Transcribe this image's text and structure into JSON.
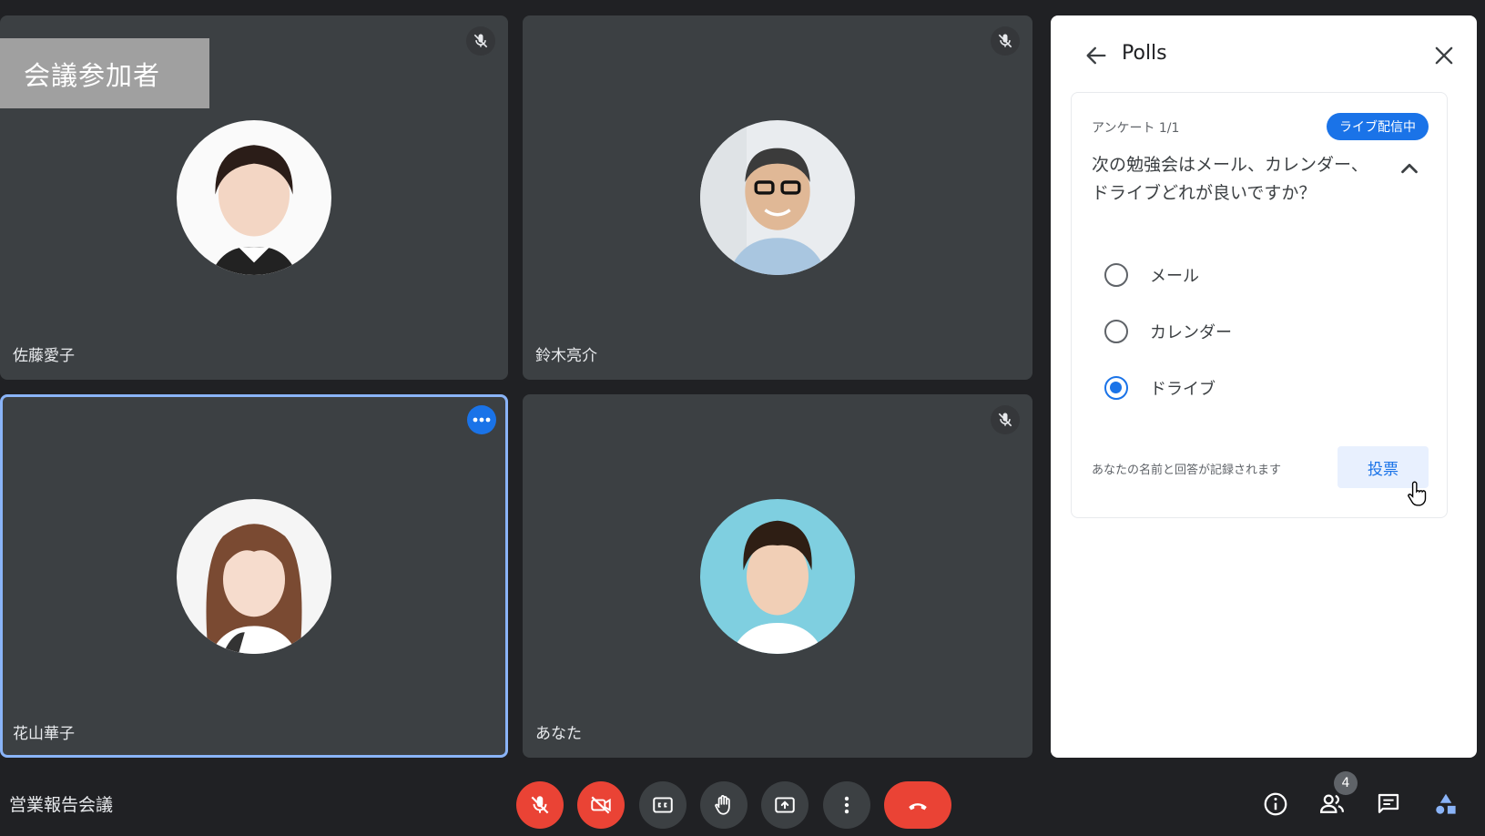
{
  "banner": {
    "label": "会議参加者"
  },
  "participants": [
    {
      "name": "佐藤愛子"
    },
    {
      "name": "鈴木亮介"
    },
    {
      "name": "花山華子"
    },
    {
      "name": "あなた"
    }
  ],
  "panel": {
    "title": "Polls",
    "poll": {
      "count": "アンケート 1/1",
      "live_badge": "ライブ配信中",
      "question": "次の勉強会はメール、カレンダー、ドライブどれが良いですか？",
      "options": [
        {
          "label": "メール",
          "selected": false
        },
        {
          "label": "カレンダー",
          "selected": false
        },
        {
          "label": "ドライブ",
          "selected": true
        }
      ],
      "record_note": "あなたの名前と回答が記録されます",
      "vote_label": "投票"
    }
  },
  "toolbar": {
    "meeting_title": "営業報告会議",
    "participant_count": "4"
  },
  "colors": {
    "accent": "#1a73e8",
    "danger": "#ea4335",
    "tile": "#3c4043",
    "background": "#202124",
    "banner": "#a0a0a0"
  }
}
